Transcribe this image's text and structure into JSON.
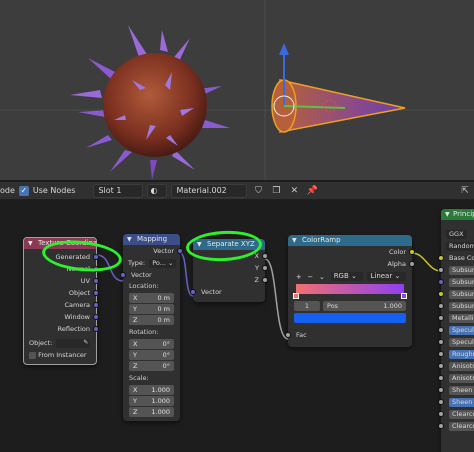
{
  "header": {
    "mode_partial": "ode",
    "use_nodes_label": "Use Nodes",
    "slot_label": "Slot 1",
    "material_name": "Material.002"
  },
  "nodes": {
    "texcoord": {
      "title": "Texture Coordinate",
      "outputs": [
        "Generated",
        "Normal",
        "UV",
        "Object",
        "Camera",
        "Window",
        "Reflection"
      ],
      "object_label": "Object:",
      "from_instancer_label": "From Instancer"
    },
    "mapping": {
      "title": "Mapping",
      "output_vector": "Vector",
      "type_label": "Type:",
      "type_value": "Po...",
      "input_vector": "Vector",
      "location_label": "Location:",
      "location": [
        {
          "axis": "X",
          "value": "0 m"
        },
        {
          "axis": "Y",
          "value": "0 m"
        },
        {
          "axis": "Z",
          "value": "0 m"
        }
      ],
      "rotation_label": "Rotation:",
      "rotation": [
        {
          "axis": "X",
          "value": "0°"
        },
        {
          "axis": "Y",
          "value": "0°"
        },
        {
          "axis": "Z",
          "value": "0°"
        }
      ],
      "scale_label": "Scale:",
      "scale": [
        {
          "axis": "X",
          "value": "1.000"
        },
        {
          "axis": "Y",
          "value": "1.000"
        },
        {
          "axis": "Z",
          "value": "1.000"
        }
      ]
    },
    "separate": {
      "title": "Separate XYZ",
      "outputs": [
        "X",
        "Y",
        "Z"
      ],
      "input_vector": "Vector"
    },
    "colorramp": {
      "title": "ColorRamp",
      "out_color": "Color",
      "out_alpha": "Alpha",
      "color_mode": "RGB",
      "interpolation": "Linear",
      "stop_index": "1",
      "pos_label": "Pos",
      "pos_value": "1.000",
      "fac_label": "Fac",
      "swatch_color": "#1560f0",
      "gradient_start": "#f07070",
      "gradient_end": "#9040f0"
    },
    "principled": {
      "title": "Principl",
      "distribution": "GGX",
      "subsurface_method": "Random",
      "inputs": [
        "Base Color",
        "Subsurfa",
        "Subsurfa",
        "Subsurfa",
        "Subsurfa",
        "Metallic",
        "Specula",
        "Specula",
        "Roughne",
        "Anisotro",
        "Anisotro",
        "Sheen",
        "Sheen Ti",
        "Clearcoa",
        "Clearcoa"
      ]
    }
  },
  "colors": {
    "accent_green": "#2ef02e",
    "node_header_texcoord": "#8a3a52",
    "node_header_vector": "#3b4e8a",
    "node_header_converter": "#2e6a8a",
    "node_header_shader": "#2a7a3a"
  }
}
